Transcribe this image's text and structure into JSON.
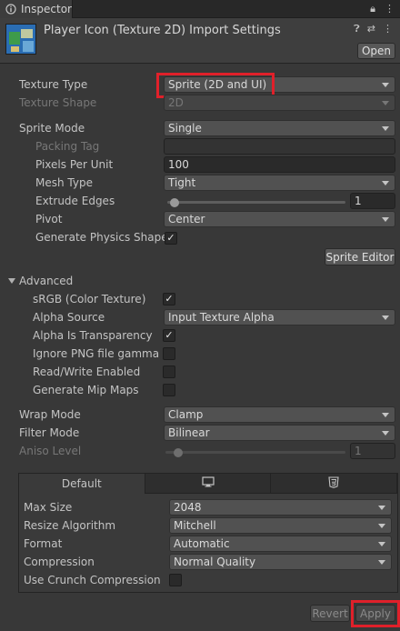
{
  "tab": {
    "title": "Inspector"
  },
  "header": {
    "title": "Player Icon (Texture 2D) Import Settings",
    "open_label": "Open"
  },
  "texture_type": {
    "label": "Texture Type",
    "value": "Sprite (2D and UI)"
  },
  "texture_shape": {
    "label": "Texture Shape",
    "value": "2D"
  },
  "sprite_mode": {
    "label": "Sprite Mode",
    "value": "Single"
  },
  "packing_tag": {
    "label": "Packing Tag",
    "value": ""
  },
  "pixels_per_unit": {
    "label": "Pixels Per Unit",
    "value": "100"
  },
  "mesh_type": {
    "label": "Mesh Type",
    "value": "Tight"
  },
  "extrude_edges": {
    "label": "Extrude Edges",
    "value": "1",
    "level": 0.05
  },
  "pivot": {
    "label": "Pivot",
    "value": "Center"
  },
  "generate_physics_shape": {
    "label": "Generate Physics Shape",
    "checked": true
  },
  "sprite_editor_label": "Sprite Editor",
  "advanced": {
    "label": "Advanced",
    "srgb": {
      "label": "sRGB (Color Texture)",
      "checked": true
    },
    "alpha_source": {
      "label": "Alpha Source",
      "value": "Input Texture Alpha"
    },
    "alpha_is_transparency": {
      "label": "Alpha Is Transparency",
      "checked": true
    },
    "ignore_png_gamma": {
      "label": "Ignore PNG file gamma",
      "checked": false
    },
    "read_write": {
      "label": "Read/Write Enabled",
      "checked": false
    },
    "mip_maps": {
      "label": "Generate Mip Maps",
      "checked": false
    }
  },
  "wrap_mode": {
    "label": "Wrap Mode",
    "value": "Clamp"
  },
  "filter_mode": {
    "label": "Filter Mode",
    "value": "Bilinear"
  },
  "aniso_level": {
    "label": "Aniso Level",
    "value": "1",
    "level": 0.1
  },
  "platform": {
    "tabs": [
      {
        "label": "Default",
        "icon": ""
      },
      {
        "label": "",
        "icon": "monitor-icon"
      },
      {
        "label": "",
        "icon": "html5-icon"
      }
    ],
    "max_size": {
      "label": "Max Size",
      "value": "2048"
    },
    "resize_algorithm": {
      "label": "Resize Algorithm",
      "value": "Mitchell"
    },
    "format": {
      "label": "Format",
      "value": "Automatic"
    },
    "compression": {
      "label": "Compression",
      "value": "Normal Quality"
    },
    "crunch": {
      "label": "Use Crunch Compression",
      "checked": false
    }
  },
  "footer": {
    "revert_label": "Revert",
    "apply_label": "Apply"
  },
  "colors": {
    "highlight": "#e0202a",
    "background": "#383838",
    "field": "#515151"
  }
}
